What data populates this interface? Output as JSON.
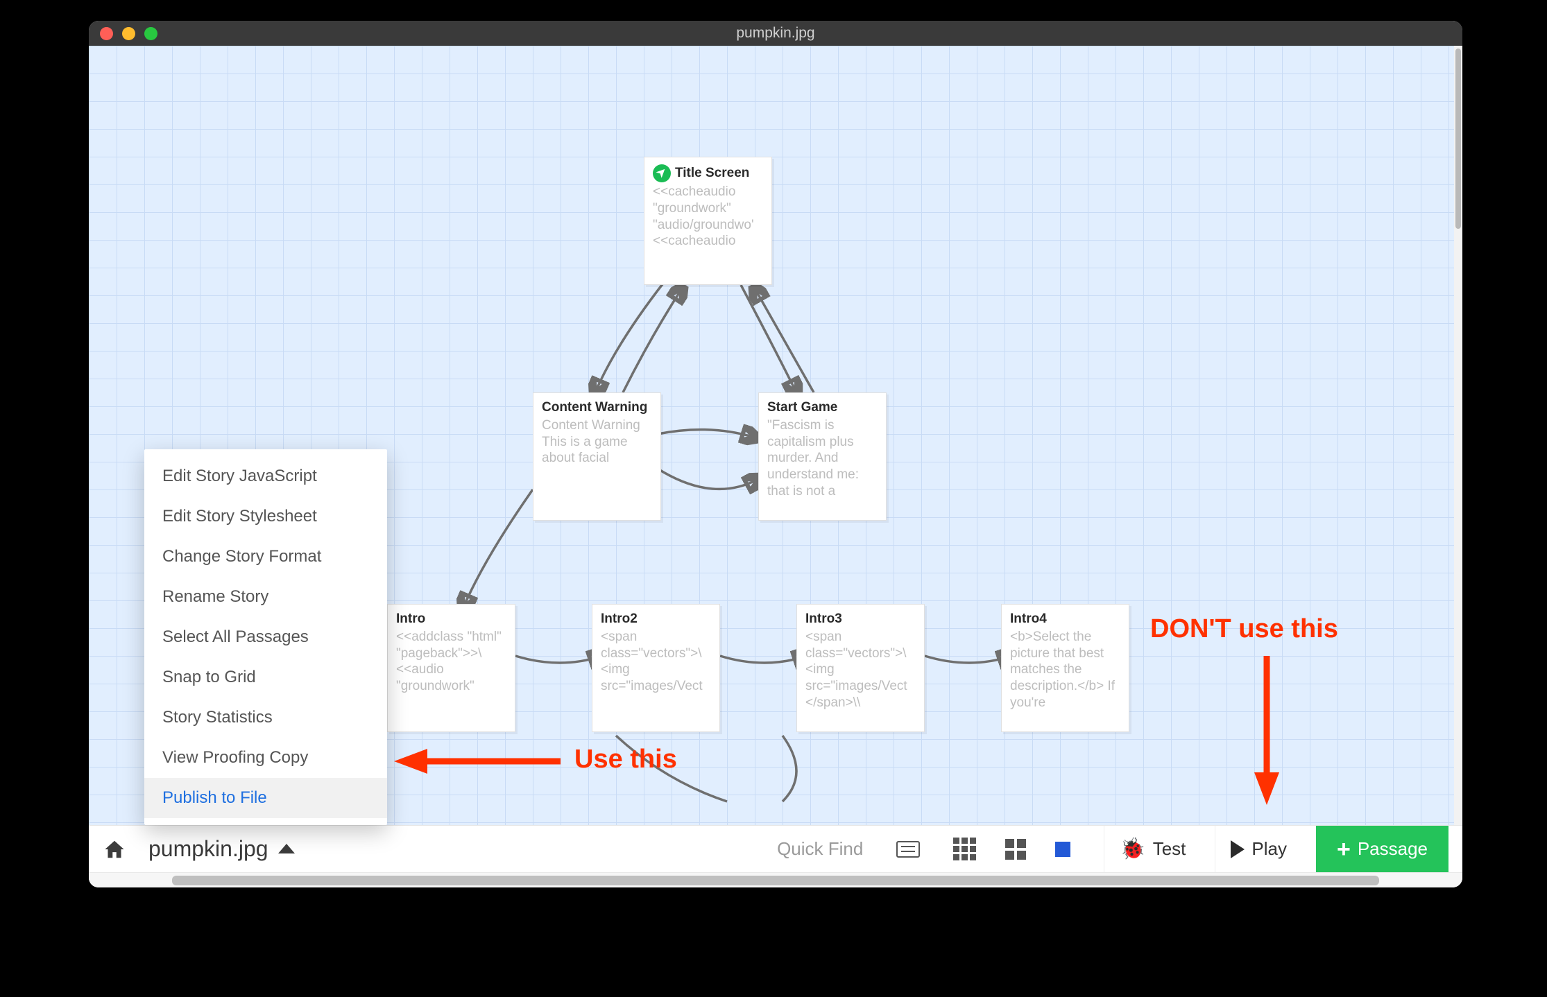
{
  "window_title": "pumpkin.jpg",
  "menu": [
    "Edit Story JavaScript",
    "Edit Story Stylesheet",
    "Change Story Format",
    "Rename Story",
    "Select All Passages",
    "Snap to Grid",
    "Story Statistics",
    "View Proofing Copy",
    "Publish to File"
  ],
  "passages": {
    "title_screen": {
      "title": "Title Screen",
      "body": "<<cacheaudio \"groundwork\" \"audio/groundwo' <<cacheaudio"
    },
    "content_warning": {
      "title": "Content Warning",
      "body": "Content Warning This is a game about facial"
    },
    "start_game": {
      "title": "Start Game",
      "body": "\"Fascism is capitalism plus murder. And understand me: that is not a"
    },
    "intro": {
      "title": "Intro",
      "body": "<<addclass \"html\" \"pageback\">>\\ <<audio \"groundwork\""
    },
    "intro2": {
      "title": "Intro2",
      "body": "<span class=\"vectors\">\\ <img src=\"images/Vect"
    },
    "intro3": {
      "title": "Intro3",
      "body": "<span class=\"vectors\">\\ <img src=\"images/Vect </span>\\\\"
    },
    "intro4": {
      "title": "Intro4",
      "body": "<b>Select the picture that best matches the description.</b> If you're"
    }
  },
  "bottombar": {
    "story_name": "pumpkin.jpg",
    "quick_find_placeholder": "Quick Find",
    "test_label": "Test",
    "play_label": "Play",
    "passage_label": "Passage"
  },
  "annotations": {
    "use_this": "Use this",
    "dont_use_this": "DON'T use this"
  }
}
